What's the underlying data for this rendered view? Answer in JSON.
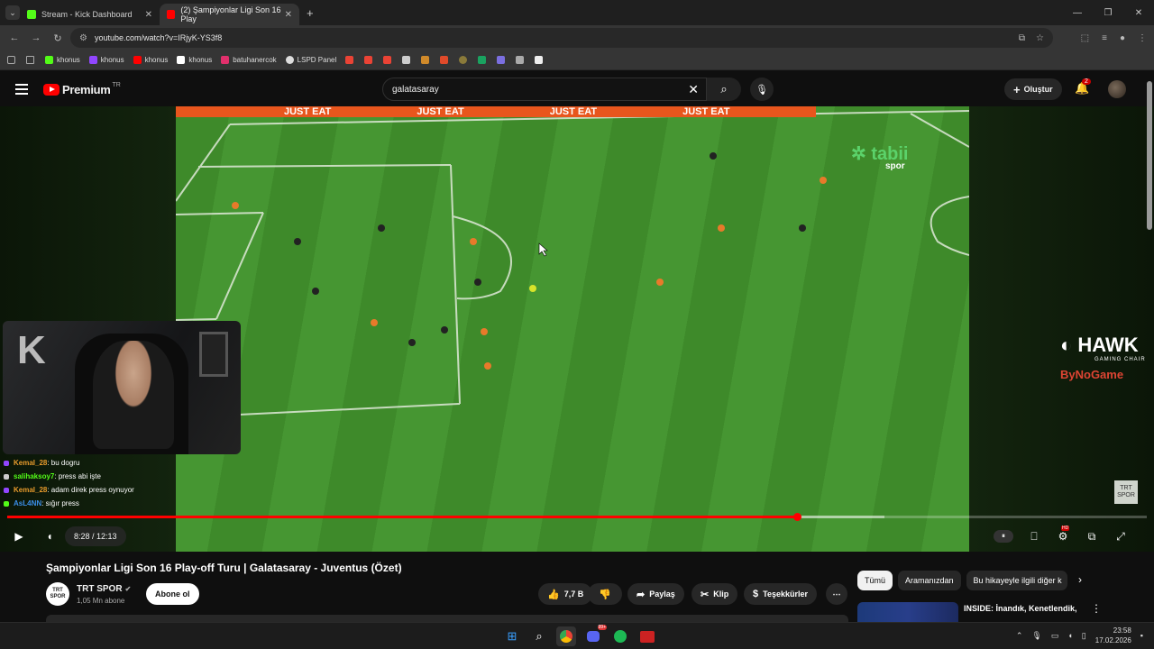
{
  "browser": {
    "tabs": [
      {
        "label": "Stream - Kick Dashboard",
        "favicon_color": "#53fc18",
        "active": false
      },
      {
        "label": "(2) Şampiyonlar Ligi Son 16 Play",
        "favicon_color": "#ff0000",
        "active": true
      }
    ],
    "url": "youtube.com/watch?v=IRjyK-YS3f8",
    "bookmarks": [
      {
        "label": "khonus",
        "color": "#53fc18"
      },
      {
        "label": "khonus",
        "color": "#9146ff"
      },
      {
        "label": "khonus",
        "color": "#ff0000"
      },
      {
        "label": "khonus",
        "color": "#ffffff"
      },
      {
        "label": "batuhanercok",
        "color": "#e1306c"
      },
      {
        "label": "LSPD Panel",
        "color": "#dddddd"
      }
    ]
  },
  "youtube": {
    "brand": "Premium",
    "region": "TR",
    "search_value": "galatasaray",
    "create_label": "Oluştur",
    "notification_count": "2"
  },
  "overlay": {
    "broadcaster_logo": "tabii",
    "broadcaster_sub": "spor",
    "sponsor_name": "HAWK",
    "sponsor_sub": "GAMING CHAIR",
    "sponsor2": "ByNoGame",
    "watermark": "TRT SPOR",
    "adboard": [
      "JUST EAT",
      "JUST EAT",
      "JUST EAT",
      "JUST EAT"
    ],
    "chat": [
      {
        "user": "Kemal_28",
        "user_color": "#e89b2c",
        "message": ": bu dogru"
      },
      {
        "user": "salihaksoy7",
        "user_color": "#53fc18",
        "message": ": press abi işte"
      },
      {
        "user": "Kemal_28",
        "user_color": "#e89b2c",
        "message": ": adam direk press oynuyor"
      },
      {
        "user": "AsL4NN",
        "user_color": "#3b8ee8",
        "message": ": sığır press"
      }
    ]
  },
  "player": {
    "current_time": "8:28",
    "duration": "12:13",
    "time_display": "8:28 / 12:13",
    "played_fraction": 0.693,
    "buffered_fraction": 0.77
  },
  "video": {
    "title": "Şampiyonlar Ligi Son 16 Play-off Turu | Galatasaray - Juventus (Özet)",
    "channel": "TRT SPOR",
    "channel_avatar_text": "TRT SPOR",
    "subscribers": "1,05 Mn abone",
    "subscribe_label": "Abone ol",
    "likes": "7,7 B",
    "share_label": "Paylaş",
    "clip_label": "Klip",
    "thanks_label": "Teşekkürler"
  },
  "recommendations": {
    "chips": [
      "Tümü",
      "Aramanızdan",
      "Bu hikayeyle ilgili diğer k"
    ],
    "first_title": "INSIDE: İnandık, Kenetlendik, Birlikte Kazandık! | Trabzonsp..."
  },
  "taskbar": {
    "time": "23:58",
    "date": "17.02.2026",
    "discord_badge": "99+"
  }
}
